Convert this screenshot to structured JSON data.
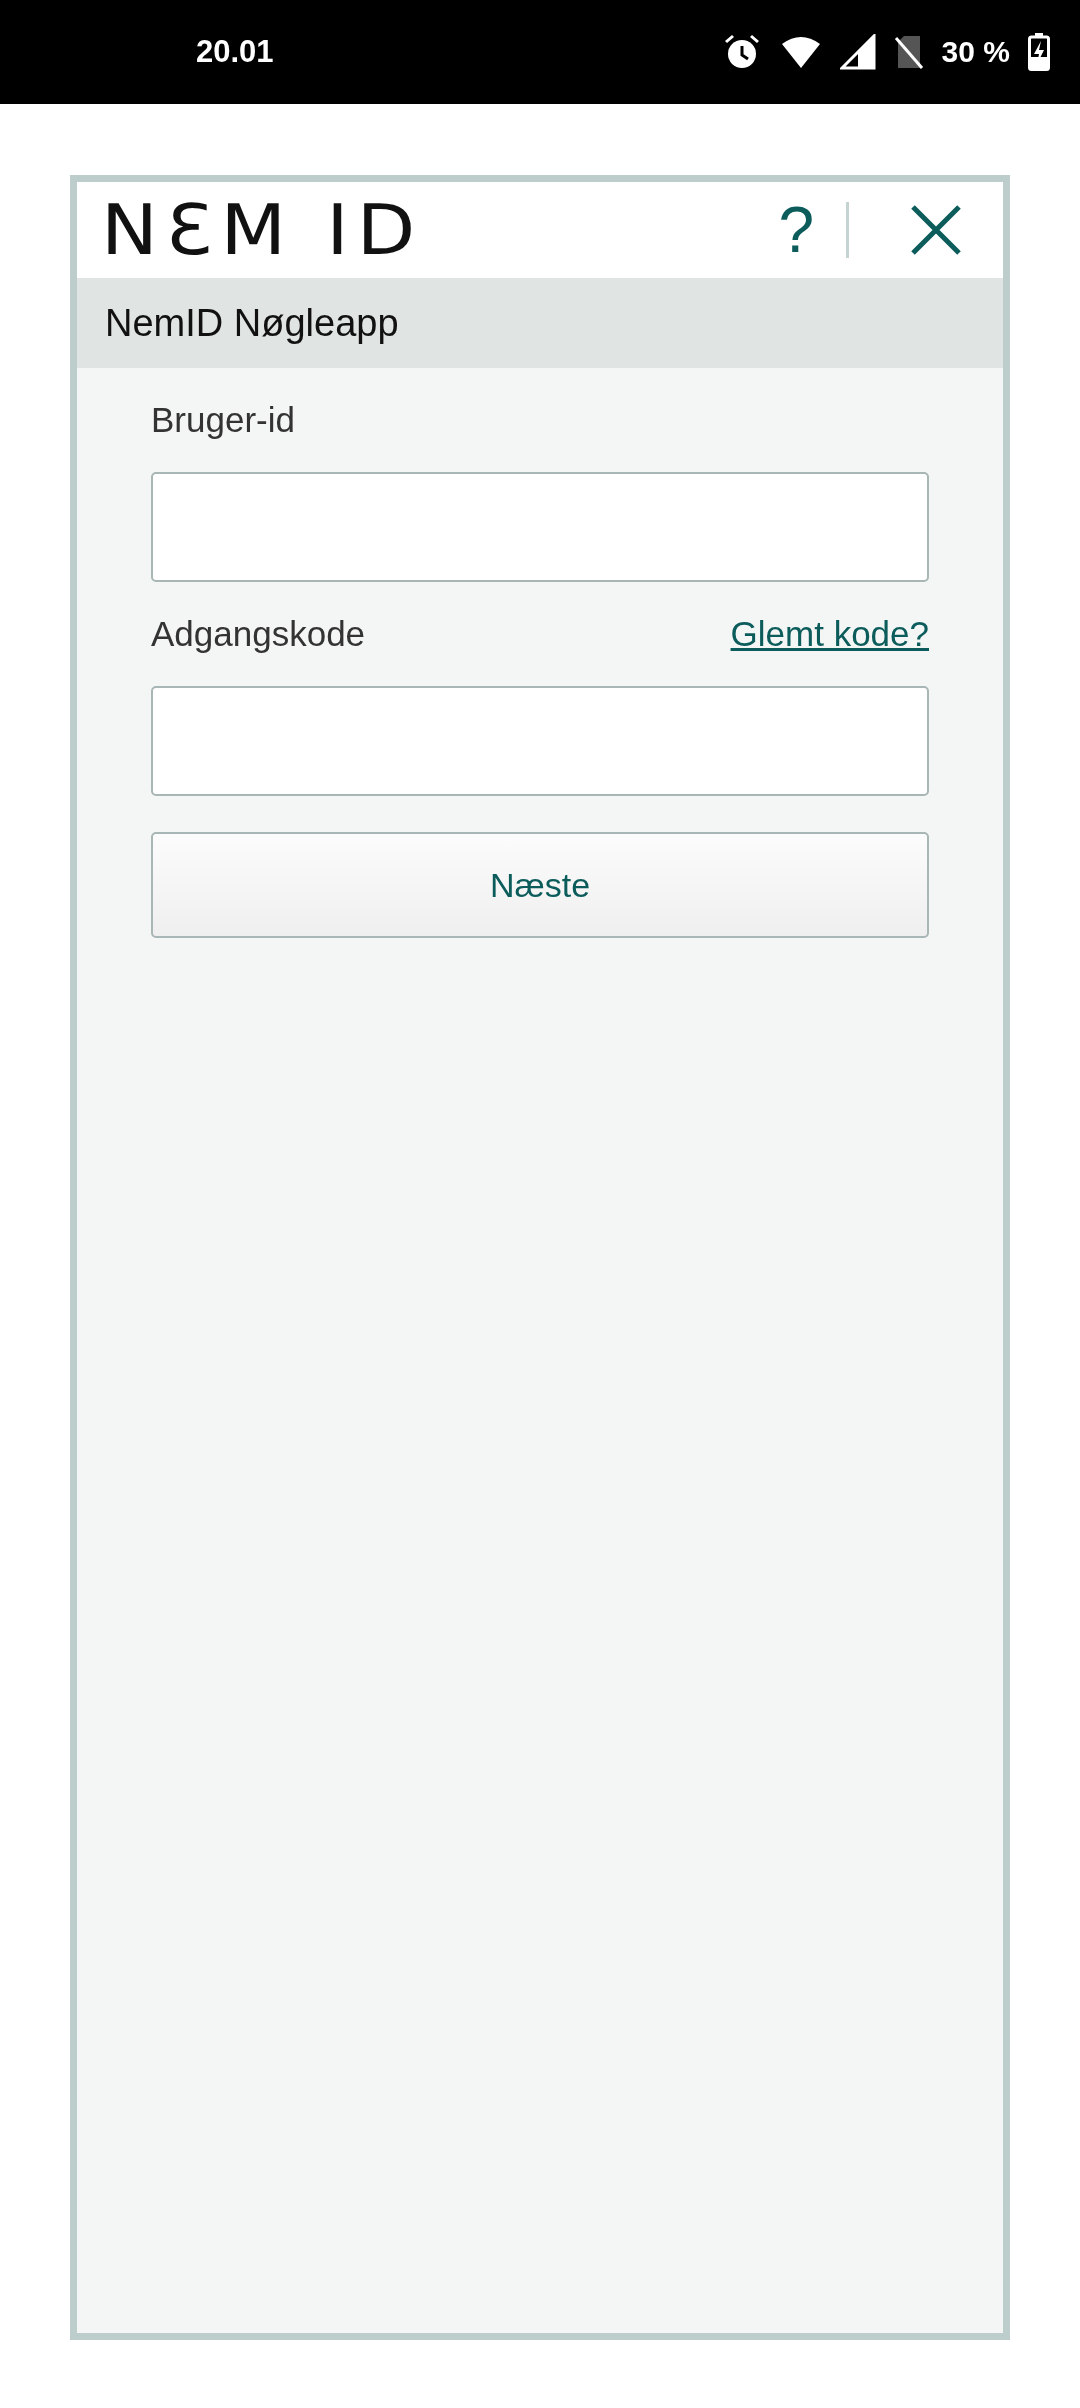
{
  "status_bar": {
    "time": "20.01",
    "battery": "30 %"
  },
  "header": {
    "logo": "NƐM ID",
    "help": "?",
    "subtitle": "NemID Nøgleapp"
  },
  "fields": [
    {
      "label": "Bruger-id"
    },
    {
      "label": "Adgangskode",
      "link": "Glemt kode?"
    }
  ],
  "button": "Næste"
}
